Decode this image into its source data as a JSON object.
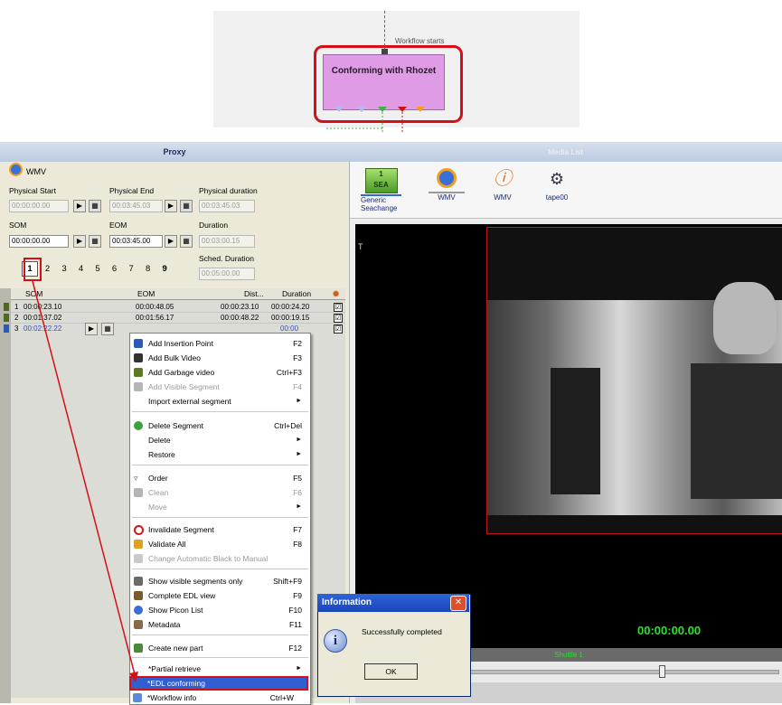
{
  "workflow": {
    "start_label": "Workflow starts",
    "node_label": "Conforming with Rhozet"
  },
  "proxy": {
    "title": "Proxy",
    "format": "WMV",
    "physical_start_label": "Physical Start",
    "physical_start": "00:00:00.00",
    "physical_end_label": "Physical End",
    "physical_end": "00:03:45.03",
    "physical_duration_label": "Physical duration",
    "physical_duration": "00:03:45.03",
    "som_label": "SOM",
    "som": "00:00:00.00",
    "eom_label": "EOM",
    "eom": "00:03:45.00",
    "duration_label": "Duration",
    "duration": "00:03:00.15",
    "sched_duration_label": "Sched. Duration",
    "sched_duration": "00:05:00.00",
    "tabs": [
      "1",
      "2",
      "3",
      "4",
      "5",
      "6",
      "7",
      "8",
      "9"
    ],
    "columns": [
      "SOM",
      "EOM",
      "Dist...",
      "Duration"
    ],
    "rows": [
      {
        "num": "1",
        "som": "00:00:23.10",
        "eom": "00:00:48.05",
        "dist": "00:00:23.10",
        "dur": "00:00:24.20",
        "check": "☑"
      },
      {
        "num": "2",
        "som": "00:01:37.02",
        "eom": "00:01:56.17",
        "dist": "00:00:48.22",
        "dur": "00:00:19.15",
        "check": "☑"
      },
      {
        "num": "3",
        "som": "00:02:22.22",
        "eom": "",
        "dist": "",
        "dur": "00:00",
        "check": "☑"
      }
    ]
  },
  "menu": {
    "items": [
      {
        "label": "Add Insertion Point",
        "shortcut": "F2"
      },
      {
        "label": "Add Bulk Video",
        "shortcut": "F3"
      },
      {
        "label": "Add Garbage video",
        "shortcut": "Ctrl+F3"
      },
      {
        "label": "Add Visible Segment",
        "shortcut": "F4"
      },
      {
        "label": "Import external segment",
        "shortcut": ""
      },
      {
        "label": "Delete Segment",
        "shortcut": "Ctrl+Del"
      },
      {
        "label": "Delete",
        "shortcut": ""
      },
      {
        "label": "Restore",
        "shortcut": ""
      },
      {
        "label": "Order",
        "shortcut": "F5"
      },
      {
        "label": "Clean",
        "shortcut": "F6"
      },
      {
        "label": "Move",
        "shortcut": ""
      },
      {
        "label": "Invalidate Segment",
        "shortcut": "F7"
      },
      {
        "label": "Validate All",
        "shortcut": "F8"
      },
      {
        "label": "Change Automatic Black to Manual",
        "shortcut": ""
      },
      {
        "label": "Show visible segments only",
        "shortcut": "Shift+F9"
      },
      {
        "label": "Complete EDL view",
        "shortcut": "F9"
      },
      {
        "label": "Show Picon List",
        "shortcut": "F10"
      },
      {
        "label": "Metadata",
        "shortcut": "F11"
      },
      {
        "label": "Create new part",
        "shortcut": "F12"
      },
      {
        "label": "*Partial retrieve",
        "shortcut": ""
      },
      {
        "label": "*EDL conforming",
        "shortcut": ""
      },
      {
        "label": "*Workflow info",
        "shortcut": "Ctrl+W"
      }
    ],
    "submenu_arrow": "►"
  },
  "media": {
    "title": "Media List",
    "items": [
      {
        "label": "Generic Seachange",
        "badge_top": "1",
        "badge_bottom": "SEA"
      },
      {
        "label": "WMV"
      },
      {
        "label": "WMV"
      },
      {
        "label": "tape00"
      }
    ],
    "video_label": "T",
    "timecode": "00:00:00.00",
    "shuttle": "Shuttle 1"
  },
  "dialog": {
    "title": "Information",
    "message": "Successfully completed",
    "ok": "OK",
    "close": "✕"
  },
  "colors": {
    "accent_red": "#d40f18",
    "node_fill": "#df9be6",
    "timecode": "#2fe02f"
  }
}
